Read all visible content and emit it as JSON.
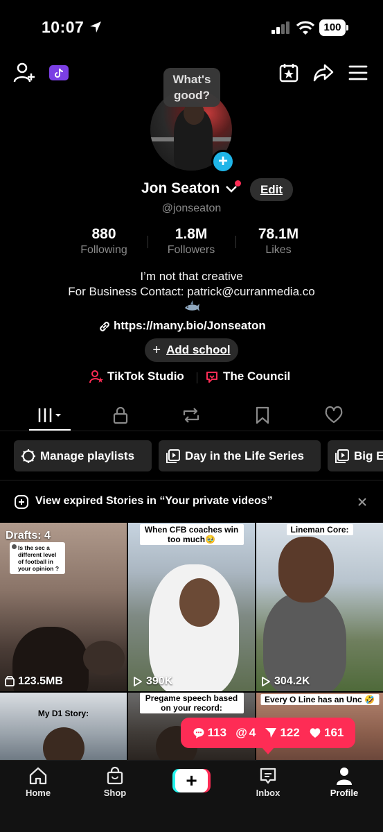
{
  "status_bar": {
    "time": "10:07",
    "battery": "100"
  },
  "profile": {
    "bubble_text": "What's good?",
    "name": "Jon Seaton",
    "edit_label": "Edit",
    "handle": "@jonseaton",
    "stats": [
      {
        "value": "880",
        "label": "Following"
      },
      {
        "value": "1.8M",
        "label": "Followers"
      },
      {
        "value": "78.1M",
        "label": "Likes"
      }
    ],
    "bio_line1": "I’m not that creative",
    "bio_line2": "For Business Contact: patrick@curranmedia.co",
    "link": "https://many.bio/Jonseaton",
    "add_school_label": "Add school",
    "tools": {
      "studio": "TikTok Studio",
      "council": "The Council"
    }
  },
  "playlists": {
    "items": [
      {
        "label": "Manage playlists",
        "icon": "gear-icon"
      },
      {
        "label": "Day in the Life Series",
        "icon": "playlist-icon"
      },
      {
        "label": "Big E",
        "icon": "playlist-icon"
      }
    ]
  },
  "notice": {
    "text": "View expired Stories in “Your private videos”"
  },
  "grid": {
    "drafts_label": "Drafts: 4",
    "drafts_question": "Is the sec a different level of football in your opinion ?",
    "drafts_size": "123.5MB",
    "cells": [
      {
        "caption": "When CFB coaches win too much🥹",
        "views": "390K"
      },
      {
        "caption": "Lineman Core:",
        "views": "304.2K"
      },
      {
        "caption": "My D1 Story:"
      },
      {
        "caption": "Pregame speech based on your record:"
      },
      {
        "caption": "Every O Line has an Unc 🤣"
      }
    ]
  },
  "notifications": {
    "comments": "113",
    "mentions": "4",
    "shares": "122",
    "likes": "161"
  },
  "bottom_nav": {
    "home": "Home",
    "shop": "Shop",
    "inbox": "Inbox",
    "profile": "Profile"
  },
  "colors": {
    "accent": "#fe2c55",
    "cyan": "#25f4ee",
    "badge_blue": "#1fb5e8",
    "chip_bg": "#262626"
  }
}
